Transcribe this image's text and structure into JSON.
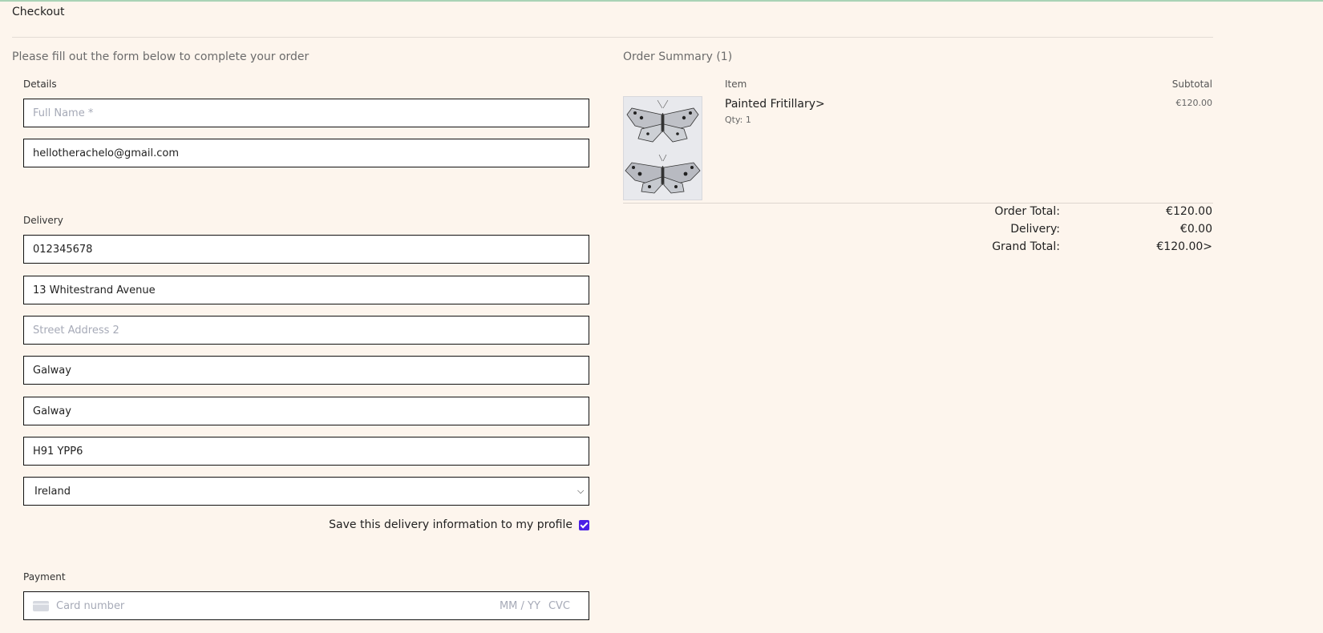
{
  "header": {
    "title": "Checkout"
  },
  "form": {
    "intro": "Please fill out the form below to complete your order",
    "details": {
      "label": "Details",
      "full_name_placeholder": "Full Name *",
      "email_value": "hellotherachelo@gmail.com"
    },
    "delivery": {
      "label": "Delivery",
      "phone_value": "012345678",
      "street1_value": "13 Whitestrand Avenue",
      "street2_placeholder": "Street Address 2",
      "town_value": "Galway",
      "county_value": "Galway",
      "postcode_value": "H91 YPP6",
      "country_value": "Ireland",
      "save_label": "Save this delivery information to my profile",
      "save_checked": true
    },
    "payment": {
      "label": "Payment",
      "card_placeholder": "Card number",
      "expiry_placeholder": "MM / YY",
      "cvc_placeholder": "CVC"
    }
  },
  "summary": {
    "title": "Order Summary (1)",
    "col_item": "Item",
    "col_subtotal": "Subtotal",
    "items": [
      {
        "name": "Painted Fritillary>",
        "qty": "Qty: 1",
        "subtotal": "€120.00",
        "image": "butterfly-drawing"
      }
    ],
    "totals": {
      "order_total_label": "Order Total:",
      "order_total_value": "€120.00",
      "delivery_label": "Delivery:",
      "delivery_value": "€0.00",
      "grand_total_label": "Grand Total:",
      "grand_total_value": "€120.00>"
    }
  },
  "colors": {
    "background": "#fdf5ed",
    "checkbox": "#4b20e6",
    "top_accent": "#a9d3b6"
  }
}
